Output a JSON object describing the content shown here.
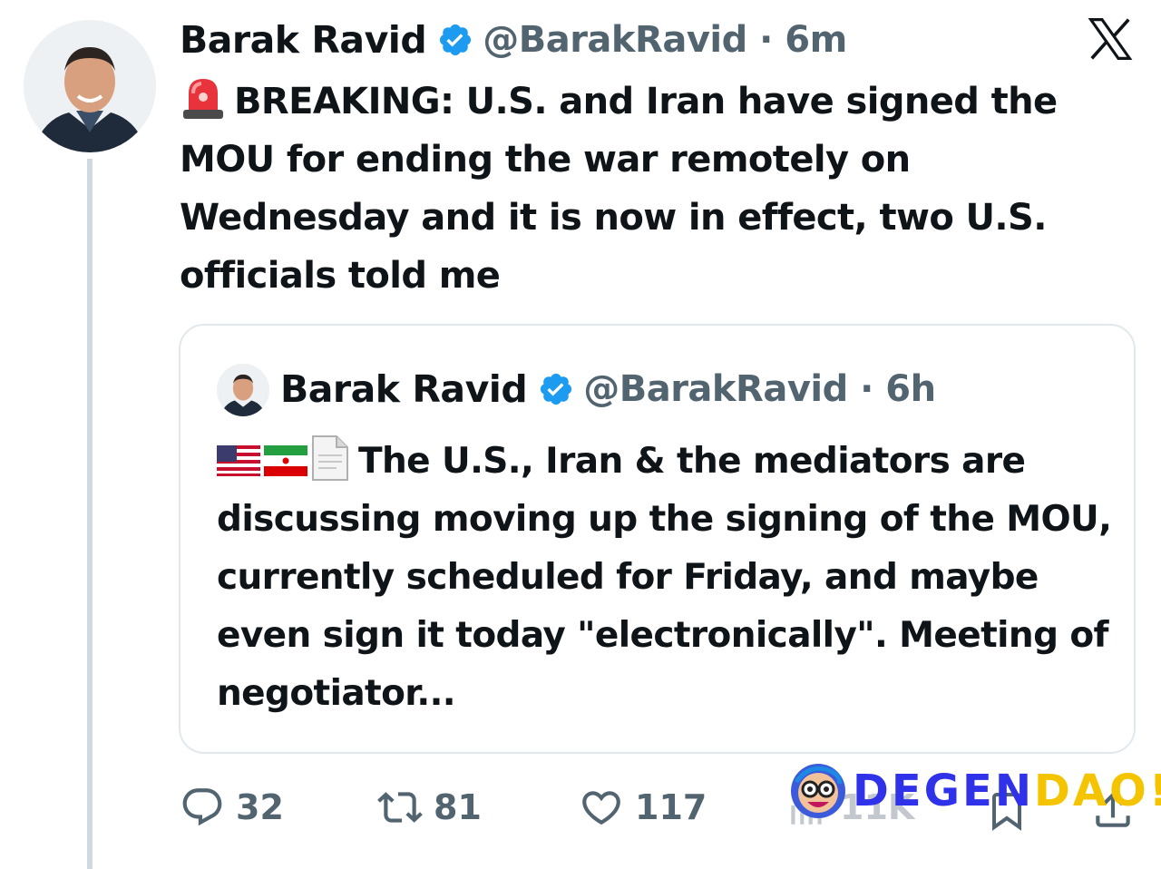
{
  "tweet": {
    "author_name": "Barak Ravid",
    "handle_time": "@BarakRavid · 6m",
    "text": "BREAKING: U.S. and Iran have signed the MOU for ending the war remotely on Wednesday and it is now in effect, two U.S. officials told me",
    "leading_icon": "siren-emoji"
  },
  "quoted": {
    "author_name": "Barak Ravid",
    "handle_time": "@BarakRavid · 6h",
    "leading_icons": [
      "us-flag-emoji",
      "iran-flag-emoji",
      "document-emoji"
    ],
    "text": "The U.S., Iran & the mediators are discussing moving up the signing of the MOU, currently scheduled for Friday, and maybe even sign it today \"electronically\". Meeting of negotiator..."
  },
  "actions": {
    "replies": "32",
    "reposts": "81",
    "likes": "117",
    "views": "11K"
  },
  "watermark": {
    "part1": "DEGEN",
    "part2": "DAO!"
  },
  "colors": {
    "verified": "#1d9bf0",
    "secondary": "#536471",
    "thread_line": "#cfd9de",
    "watermark_blue": "#2f32e8",
    "watermark_yellow": "#f5c400"
  }
}
